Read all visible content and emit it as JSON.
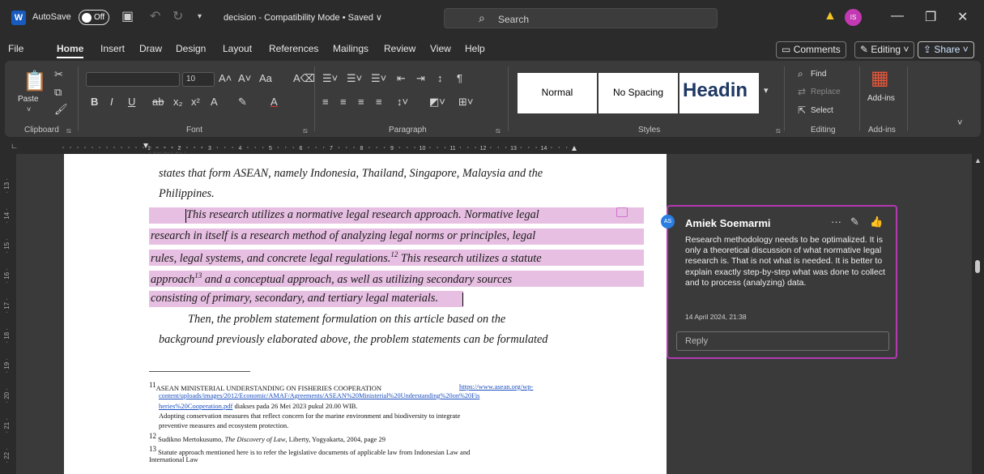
{
  "titlebar": {
    "autosave_label": "AutoSave",
    "autosave_state": "Off",
    "doc_title": "decision  -  Compatibility Mode • Saved ∨",
    "search_placeholder": "Search",
    "user_initials": "IS"
  },
  "menu": {
    "items": [
      "File",
      "Home",
      "Insert",
      "Draw",
      "Design",
      "Layout",
      "References",
      "Mailings",
      "Review",
      "View",
      "Help"
    ],
    "comments_label": "Comments",
    "editing_label": "Editing ˅",
    "share_label": "Share ˅"
  },
  "ribbon": {
    "clipboard": {
      "paste_label": "Paste",
      "group_label": "Clipboard"
    },
    "font": {
      "size": "10",
      "group_label": "Font"
    },
    "paragraph": {
      "group_label": "Paragraph"
    },
    "styles": {
      "items": [
        "Normal",
        "No Spacing",
        "Headin"
      ],
      "group_label": "Styles"
    },
    "editing": {
      "find_label": "Find",
      "replace_label": "Replace",
      "select_label": "Select",
      "group_label": "Editing"
    },
    "addins": {
      "label": "Add-ins",
      "group_label": "Add-ins"
    }
  },
  "ruler": {
    "horizontal_numbers": [
      "1",
      "2",
      "3",
      "4",
      "5",
      "6",
      "7",
      "8",
      "9",
      "10",
      "11",
      "12",
      "13",
      "14"
    ],
    "vertical_numbers": [
      "13",
      "14",
      "15",
      "16",
      "17",
      "18",
      "19",
      "20",
      "21",
      "22"
    ]
  },
  "document": {
    "lines": [
      "states that form ASEAN, namely Indonesia, Thailand, Singapore, Malaysia and the",
      "Philippines."
    ],
    "highlighted_lines": [
      "This research utilizes a normative legal research approach. Normative legal",
      "research in itself is a research method of analyzing legal norms or principles, legal",
      "rules, legal systems, and concrete legal regulations.",
      " This research utilizes a statute",
      "approach",
      " and a conceptual approach, as well as utilizing secondary sources",
      "consisting of primary, secondary, and tertiary legal materials."
    ],
    "sup12": "12",
    "sup13": "13",
    "after_lines": [
      "Then, the problem statement formulation on this article based on the",
      "background previously elaborated above, the problem statements can be formulated"
    ],
    "footnotes": {
      "fn11_num": "11",
      "fn11_text": "ASEAN   MINISTERIAL   UNDERSTANDING   ON   FISHERIES   COOPERATION",
      "fn11_link1": "https://www.asean.org/wp-",
      "fn11_link2": "content/uploads/images/2012/Economic/AMAF/Agreements/ASEAN%20Ministerial%20Understanding%20on%20Fis",
      "fn11_link3": "heries%20Cooperation.pdf",
      "fn11_after": " diakses pada 26 Mei 2023 pukul 20.00 WIB.",
      "fn11_line4": "Adopting conservation measures that reflect concern for the marine environment and biodiversity to integrate",
      "fn11_line5": "preventive measures and ecosystem protection.",
      "fn12_num": "12",
      "fn12_text_pre": "Sudikno Mertokusumo, ",
      "fn12_title": "The Discovery of Law",
      "fn12_text_post": ", Liberty, Yogyakarta, 2004,  page 29",
      "fn13_num": "13",
      "fn13_line1": "Statute approach mentioned here is to refer the legislative documents of applicable law from Indonesian Law and",
      "fn13_line2": "International Law"
    }
  },
  "comment": {
    "initials": "AS",
    "author": "Amiek Soemarmi",
    "text": "Research methodology needs to be optimalized. It is only a theoretical discussion of what normative legal research is. That is not what is needed. It is better to explain exactly step-by-step what was done to collect and to process (analyzing) data.",
    "timestamp": "14 April 2024, 21:38",
    "reply_placeholder": "Reply"
  },
  "colors": {
    "highlight": "#e7bfe2",
    "comment_border": "#b339b3",
    "accent": "#185abd"
  }
}
